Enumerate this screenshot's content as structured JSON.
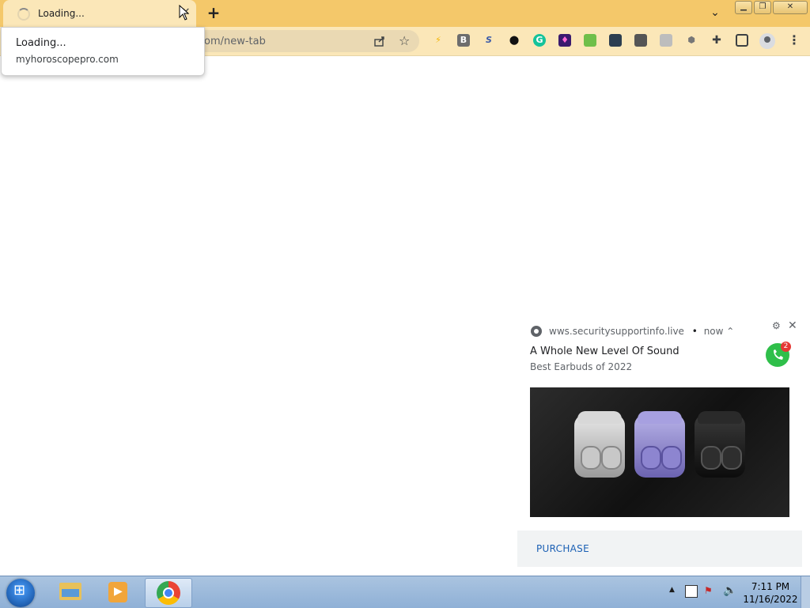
{
  "browser": {
    "tab": {
      "title": "Loading..."
    },
    "omnibox": {
      "url_fragment": "om/new-tab"
    },
    "extensions": [
      "pikachu-extension-icon",
      "b-extension-icon",
      "s-extension-icon",
      "location-pin-extension-icon",
      "grammarly-extension-icon",
      "purple-extension-icon",
      "green-extension-icon",
      "photo-extension-icon",
      "camera-extension-icon",
      "gallery-extension-icon",
      "hexagon-extension-icon",
      "puzzle-icon",
      "sidepanel-icon"
    ]
  },
  "hovercard": {
    "title": "Loading...",
    "domain": "myhoroscopepro.com"
  },
  "notification": {
    "origin": "wws.securitysupportinfo.live",
    "separator": "•",
    "time": "now ⌃",
    "title": "A Whole New Level Of Sound",
    "body": "Best Earbuds of 2022",
    "badge_count": "2",
    "action": "PURCHASE"
  },
  "taskbar": {
    "time": "7:11 PM",
    "date": "11/16/2022"
  },
  "colors": {
    "titlebar": "#f4c86a",
    "tab_active": "#fbe7b8",
    "link": "#1a5fb4"
  }
}
